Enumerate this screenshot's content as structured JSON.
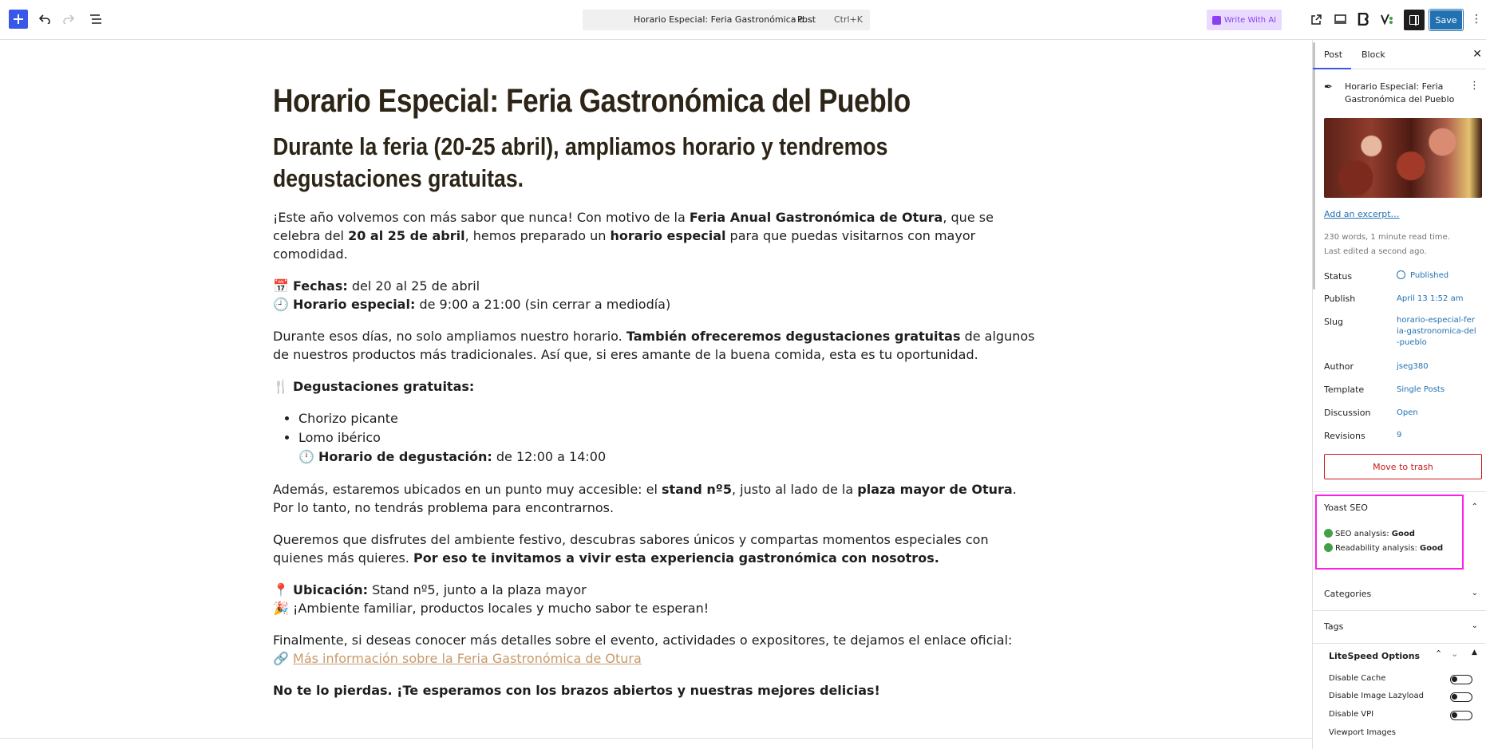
{
  "toolbar": {
    "command_title": "Horario Especial: Feria Gastronómica d...",
    "command_post_type": "· Post",
    "command_shortcut": "Ctrl+K",
    "ai_button_label": "Write With AI",
    "save_label": "Save"
  },
  "post": {
    "title": "Horario Especial: Feria Gastronómica del Pueblo",
    "subtitle": "Durante la feria (20-25 abril), ampliamos horario y tendremos degustaciones gratuitas.",
    "intro": {
      "t1": "¡Este año volvemos con más sabor que nunca! Con motivo de la ",
      "b1": "Feria Anual Gastronómica de Otura",
      "t2": ", que se celebra del ",
      "b2": "20 al 25 de abril",
      "t3": ", hemos preparado un ",
      "b3": "horario especial",
      "t4": " para que puedas visitarnos con mayor comodidad."
    },
    "dates": {
      "icon1": "📅 ",
      "label1": "Fechas:",
      "value1": " del 20 al 25 de abril",
      "icon2": "🕘 ",
      "label2": "Horario especial:",
      "value2": " de 9:00 a 21:00 (sin cerrar a mediodía)"
    },
    "tastings_para": {
      "t1": "Durante esos días, no solo ampliamos nuestro horario. ",
      "b1": "También ofreceremos degustaciones gratuitas",
      "t2": " de algunos de nuestros productos más tradicionales. Así que, si eres amante de la buena comida, esta es tu oportunidad."
    },
    "tastings_heading": {
      "icon": "🍴 ",
      "label": "Degustaciones gratuitas:"
    },
    "tasting_items": [
      "Chorizo picante",
      "Lomo ibérico"
    ],
    "tasting_time": {
      "icon": "🕛 ",
      "label": "Horario de degustación:",
      "value": " de 12:00 a 14:00"
    },
    "location_para": {
      "t1": "Además, estaremos ubicados en un punto muy accesible: el ",
      "b1": "stand nº5",
      "t2": ", justo al lado de la ",
      "b2": "plaza mayor de Otura",
      "t3": ". Por lo tanto, no tendrás problema para encontrarnos."
    },
    "invite_para": {
      "t1": "Queremos que disfrutes del ambiente festivo, descubras sabores únicos y compartas momentos especiales con quienes más quieres. ",
      "b1": "Por eso te invitamos a vivir esta experiencia gastronómica con nosotros."
    },
    "location": {
      "icon1": "📍 ",
      "label1": "Ubicación:",
      "value1": " Stand nº5, junto a la plaza mayor",
      "icon2": "🎉 ",
      "value2": "¡Ambiente familiar, productos locales y mucho sabor te esperan!"
    },
    "more_info": {
      "t1": "Finalmente, si deseas conocer más detalles sobre el evento, actividades o expositores, te dejamos el enlace oficial:",
      "icon": "🔗 ",
      "link": "Más información sobre la Feria Gastronómica de Otura"
    },
    "closing": "No te lo pierdas. ¡Te esperamos con los brazos abiertos y nuestras mejores delicias!"
  },
  "sidebar": {
    "tabs": [
      "Post",
      "Block"
    ],
    "post_title": "Horario Especial: Feria Gastronómica del Pueblo",
    "excerpt_link": "Add an excerpt…",
    "meta_words": "230 words, 1 minute read time.",
    "meta_edited": "Last edited a second ago.",
    "rows": {
      "status_label": "Status",
      "status_value": "Published",
      "publish_label": "Publish",
      "publish_value": "April 13 1:52 am",
      "slug_label": "Slug",
      "slug_value": "horario-especial-feria-gastronomica-del-pueblo",
      "author_label": "Author",
      "author_value": "jseg380",
      "template_label": "Template",
      "template_value": "Single Posts",
      "discussion_label": "Discussion",
      "discussion_value": "Open",
      "revisions_label": "Revisions",
      "revisions_value": "9"
    },
    "trash_label": "Move to trash",
    "yoast": {
      "title": "Yoast SEO",
      "seo_label": "SEO analysis: ",
      "seo_value": "Good",
      "readability_label": "Readability analysis: ",
      "readability_value": "Good"
    },
    "categories": "Categories",
    "tags": "Tags",
    "litespeed": {
      "title": "LiteSpeed Options",
      "options": [
        "Disable Cache",
        "Disable Image Lazyload",
        "Disable VPI",
        "Viewport Images"
      ]
    }
  }
}
